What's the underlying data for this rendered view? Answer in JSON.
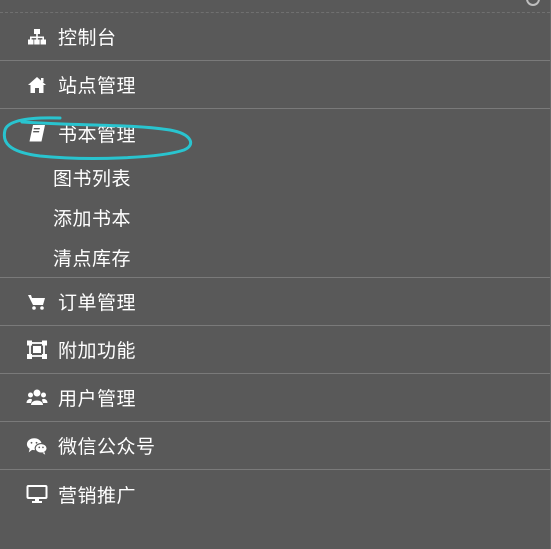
{
  "menu": [
    {
      "label": "控制台",
      "icon": "sitemap-icon"
    },
    {
      "label": "站点管理",
      "icon": "home-icon"
    },
    {
      "label": "书本管理",
      "icon": "book-icon",
      "children": [
        {
          "label": "图书列表"
        },
        {
          "label": "添加书本"
        },
        {
          "label": "清点库存"
        }
      ]
    },
    {
      "label": "订单管理",
      "icon": "cart-icon"
    },
    {
      "label": "附加功能",
      "icon": "crop-icon"
    },
    {
      "label": "用户管理",
      "icon": "users-icon"
    },
    {
      "label": "微信公众号",
      "icon": "wechat-icon"
    },
    {
      "label": "营销推广",
      "icon": "monitor-icon"
    }
  ],
  "colors": {
    "background": "#595959",
    "text": "#ffffff",
    "divider": "#7a7a7a",
    "annotation": "#29c4cf"
  }
}
